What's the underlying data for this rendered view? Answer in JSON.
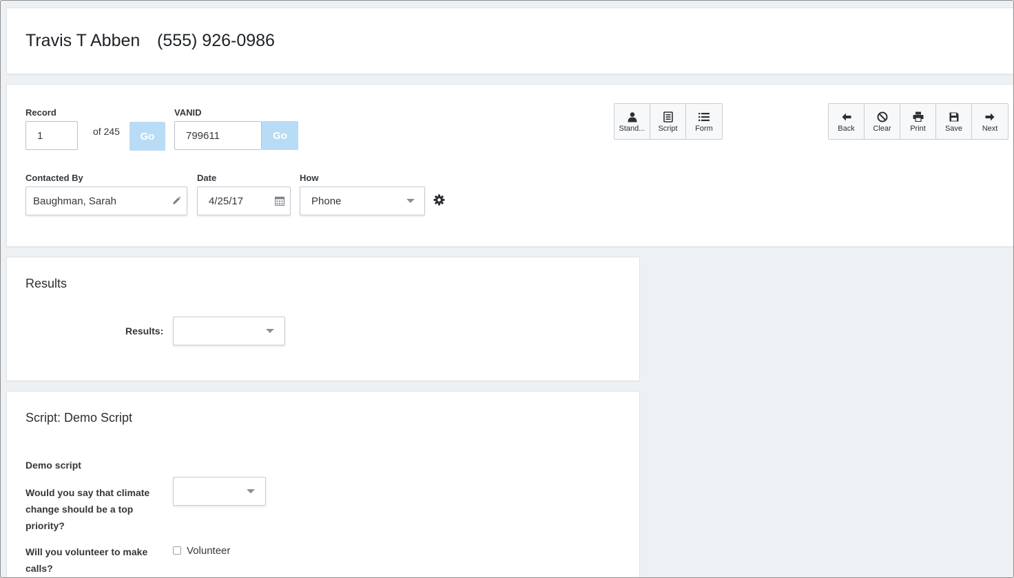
{
  "contact": {
    "name": "Travis T Abben",
    "phone": "(555) 926-0986"
  },
  "record": {
    "label": "Record",
    "value": "1",
    "of_text": "of 245",
    "go_label": "Go"
  },
  "vanid": {
    "label": "VANID",
    "value": "799611",
    "go_label": "Go"
  },
  "contacted_by": {
    "label": "Contacted By",
    "value": "Baughman, Sarah"
  },
  "date": {
    "label": "Date",
    "value": "4/25/17"
  },
  "how": {
    "label": "How",
    "value": "Phone"
  },
  "view_toolbar": [
    {
      "label": "Stand...",
      "icon": "person-icon"
    },
    {
      "label": "Script",
      "icon": "script-icon"
    },
    {
      "label": "Form",
      "icon": "list-icon"
    }
  ],
  "nav_toolbar": [
    {
      "label": "Back",
      "icon": "arrow-left-icon"
    },
    {
      "label": "Clear",
      "icon": "ban-icon"
    },
    {
      "label": "Print",
      "icon": "printer-icon"
    },
    {
      "label": "Save",
      "icon": "floppy-icon"
    },
    {
      "label": "Next",
      "icon": "arrow-right-icon"
    }
  ],
  "results": {
    "title": "Results",
    "field_label": "Results:",
    "value": ""
  },
  "script": {
    "title": "Script: Demo Script",
    "subtitle": "Demo script",
    "question1": "Would you say that climate change should be a top priority?",
    "question1_value": "",
    "question2": "Will you volunteer to make calls?",
    "volunteer_label": "Volunteer"
  },
  "colors": {
    "go_button": "#b8dcf5",
    "background": "#eef1f4",
    "card": "#ffffff"
  }
}
